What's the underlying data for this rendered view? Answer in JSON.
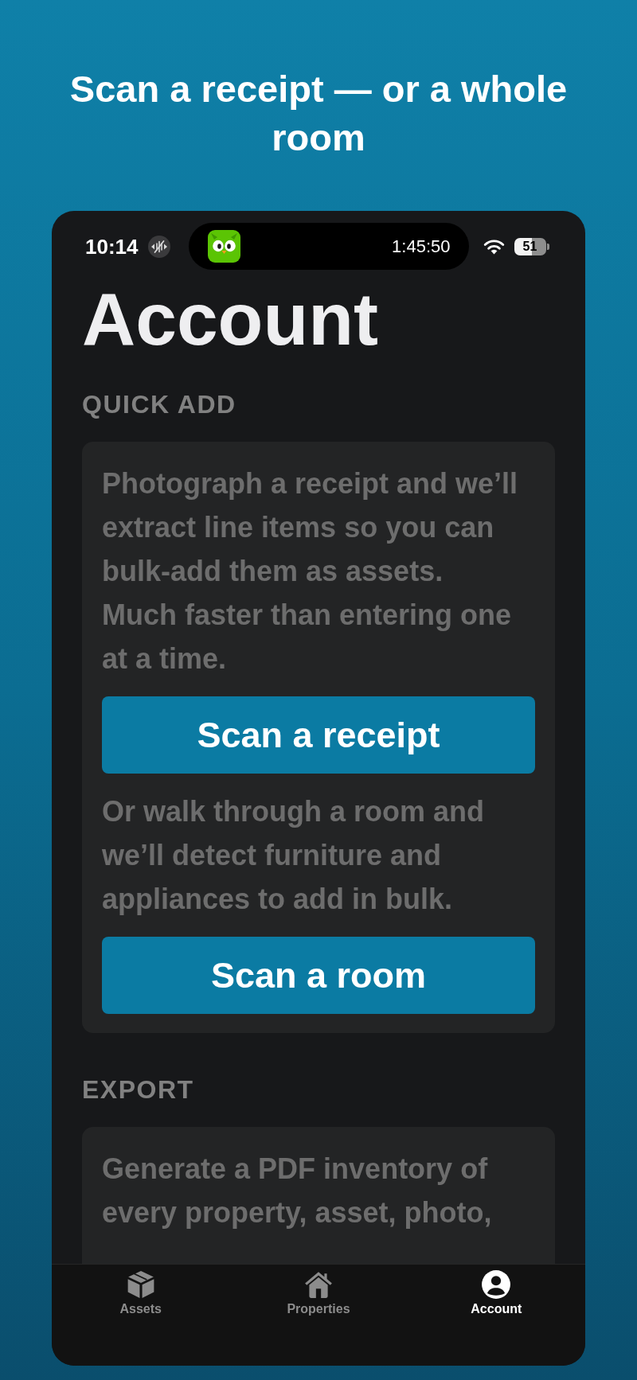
{
  "header": {
    "title": "Scan a receipt — or a whole room"
  },
  "status_bar": {
    "time": "10:14",
    "timer": "1:45:50",
    "battery": "51"
  },
  "page": {
    "title": "Account"
  },
  "sections": [
    {
      "heading": "QUICK ADD",
      "blocks": [
        {
          "kind": "text",
          "text": "Photograph a receipt and we’ll extract line items so you can bulk-add them as assets. Much faster than entering one at a time."
        },
        {
          "kind": "button",
          "label": "Scan a receipt"
        },
        {
          "kind": "text",
          "text": "Or walk through a room and we’ll detect furniture and appliances to add in bulk."
        },
        {
          "kind": "button",
          "label": "Scan a room"
        }
      ]
    },
    {
      "heading": "EXPORT",
      "blocks": [
        {
          "kind": "text",
          "text": "Generate a PDF inventory of every property, asset, photo,"
        }
      ]
    }
  ],
  "tabs": [
    {
      "label": "Assets",
      "selected": false
    },
    {
      "label": "Properties",
      "selected": false
    },
    {
      "label": "Account",
      "selected": true
    }
  ]
}
